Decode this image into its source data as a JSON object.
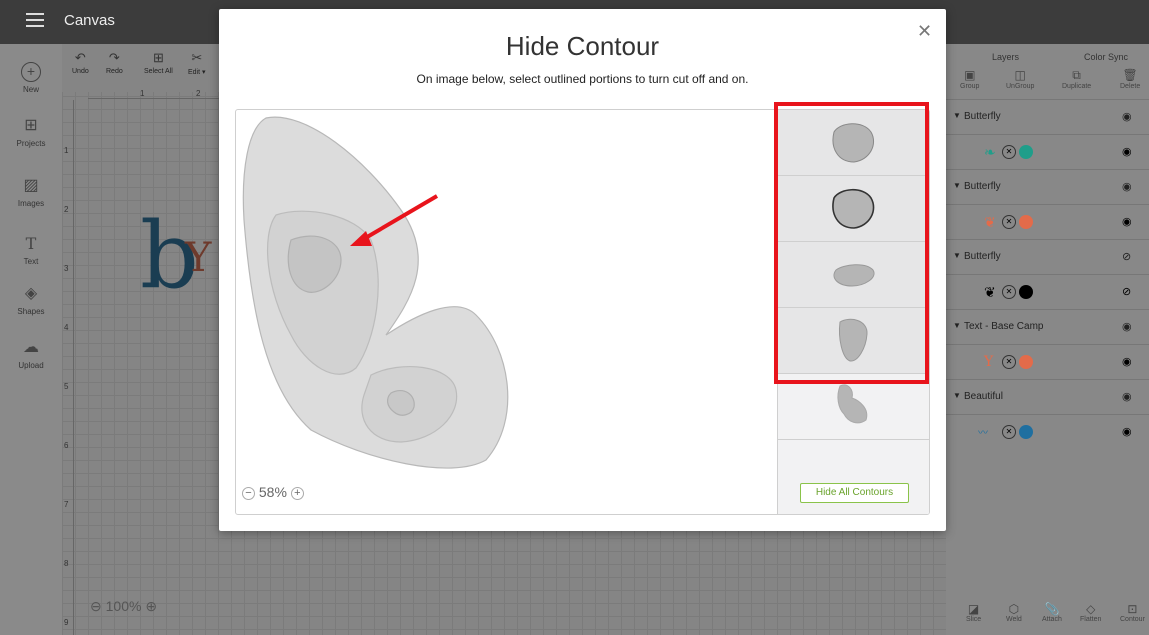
{
  "app": {
    "title": "Canvas"
  },
  "sidebar": {
    "items": [
      {
        "label": "New",
        "icon": "plus-circle-icon"
      },
      {
        "label": "Projects",
        "icon": "projects-icon"
      },
      {
        "label": "Images",
        "icon": "image-icon"
      },
      {
        "label": "Text",
        "icon": "text-icon"
      },
      {
        "label": "Shapes",
        "icon": "shapes-icon"
      },
      {
        "label": "Upload",
        "icon": "upload-icon"
      }
    ]
  },
  "toolbar": {
    "undo": "Undo",
    "redo": "Redo",
    "select_all": "Select All",
    "edit": "Edit ▾"
  },
  "canvas": {
    "zoom": "100%",
    "ruler_top": [
      "1",
      "2"
    ],
    "ruler_left": [
      "1",
      "2",
      "3",
      "4",
      "5",
      "6",
      "7",
      "8",
      "9"
    ]
  },
  "right_panel": {
    "tabs": {
      "layers": "Layers",
      "color_sync": "Color Sync"
    },
    "tools": [
      "Group",
      "UnGroup",
      "Duplicate",
      "Delete"
    ],
    "layers": [
      {
        "name": "Butterfly",
        "color": "#1f9e8a",
        "hidden": false
      },
      {
        "name": "Butterfly",
        "color": "#e36b4a",
        "hidden": false
      },
      {
        "name": "Butterfly",
        "color": "#000000",
        "hidden": true
      },
      {
        "name": "Text - Base Camp",
        "color": "#e36b4a",
        "hidden": false
      },
      {
        "name": "Beautiful",
        "color": "#1f6fa0",
        "hidden": false
      }
    ],
    "bottom_tools": [
      "Slice",
      "Weld",
      "Attach",
      "Flatten",
      "Contour"
    ]
  },
  "modal": {
    "title": "Hide Contour",
    "subtitle": "On image below, select outlined portions to turn cut off and on.",
    "zoom": "58%",
    "hide_all_label": "Hide All Contours",
    "close_icon": "close-icon"
  },
  "colors": {
    "accent_green": "#8ac34a",
    "highlight_red": "#e8141c"
  }
}
